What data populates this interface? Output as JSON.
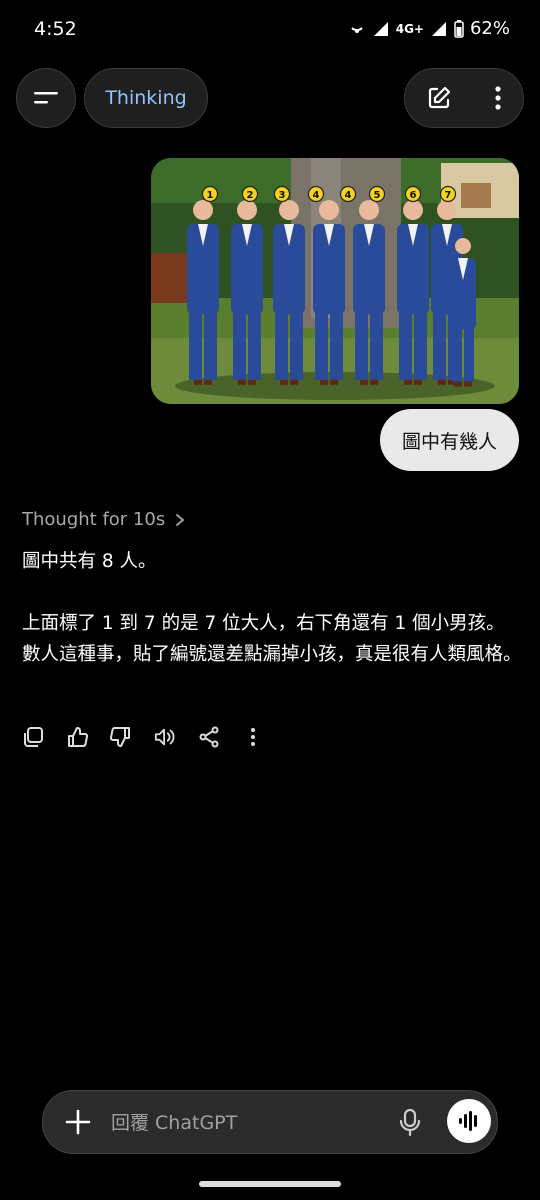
{
  "status_bar": {
    "time": "4:52",
    "battery": "62%",
    "network": "4G+"
  },
  "header": {
    "model_label": "Thinking"
  },
  "image_labels": [
    "1",
    "2",
    "3",
    "4",
    "4",
    "5",
    "6",
    "7"
  ],
  "user_message": "圖中有幾人",
  "assistant": {
    "thought_label": "Thought for 10s",
    "paragraphs": [
      "圖中共有 8 人。",
      "上面標了 1 到 7 的是 7 位大人，右下角還有 1 個小男孩。數人這種事，貼了編號還差點漏掉小孩，真是很有人類風格。"
    ]
  },
  "composer": {
    "placeholder": "回覆 ChatGPT"
  },
  "colors": {
    "background": "#000000",
    "model_accent": "#8ec3ff",
    "suit_blue": "#2a4a9a",
    "bubble": "#e9e9e9"
  }
}
